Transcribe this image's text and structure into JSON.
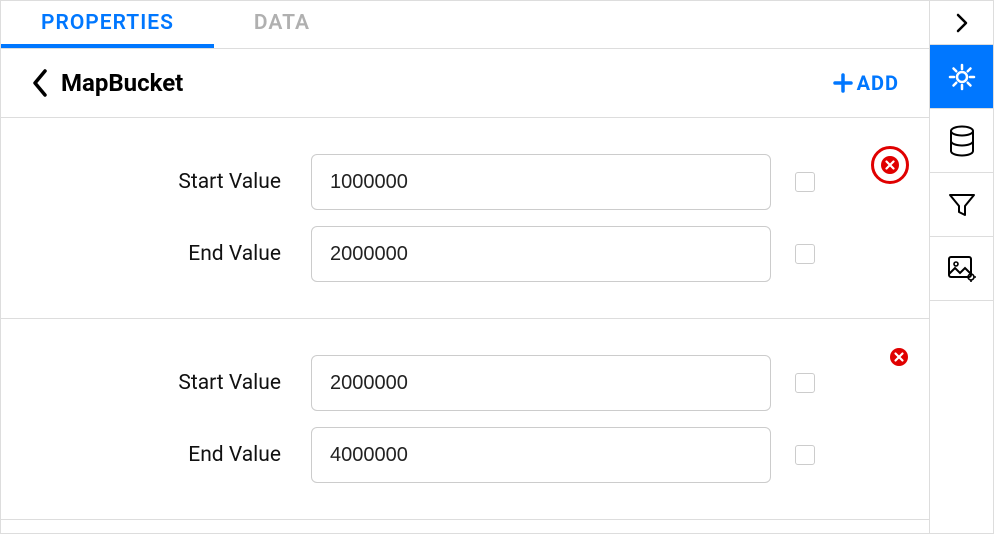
{
  "tabs": [
    {
      "label": "PROPERTIES",
      "active": true
    },
    {
      "label": "DATA",
      "active": false
    }
  ],
  "header": {
    "title": "MapBucket",
    "add_label": "ADD"
  },
  "groups": [
    {
      "highlighted": true,
      "rows": [
        {
          "label": "Start Value",
          "value": "1000000"
        },
        {
          "label": "End Value",
          "value": "2000000"
        }
      ]
    },
    {
      "highlighted": false,
      "rows": [
        {
          "label": "Start Value",
          "value": "2000000"
        },
        {
          "label": "End Value",
          "value": "4000000"
        }
      ]
    }
  ],
  "sidebar": {
    "items": [
      {
        "name": "collapse",
        "icon": "chevron-right"
      },
      {
        "name": "settings",
        "icon": "gear",
        "active": true
      },
      {
        "name": "database",
        "icon": "database"
      },
      {
        "name": "filter",
        "icon": "filter"
      },
      {
        "name": "image-settings",
        "icon": "image-gear"
      }
    ]
  }
}
